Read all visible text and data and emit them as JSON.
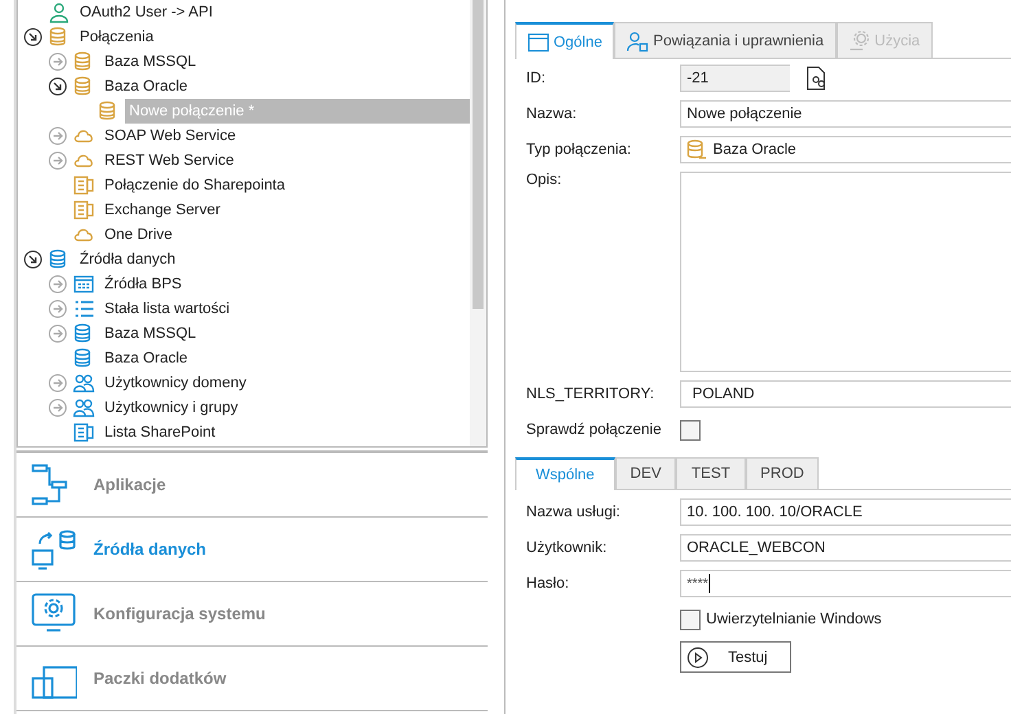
{
  "tree": [
    {
      "label": "OAuth2 User -> API",
      "kind": "user",
      "color": "#2aa87a",
      "selected": false
    },
    {
      "label": "Połączenia",
      "kind": "database",
      "color": "#d9a441",
      "expanded": true,
      "selected": false,
      "children": [
        {
          "label": "Baza MSSQL",
          "kind": "database",
          "color": "#d9a441",
          "expanded": false,
          "selected": false
        },
        {
          "label": "Baza Oracle",
          "kind": "database",
          "color": "#d9a441",
          "expanded": true,
          "selected": false,
          "children": [
            {
              "label": "Nowe połączenie *",
              "kind": "database",
              "color": "#d9a441",
              "selected": true
            }
          ]
        },
        {
          "label": "SOAP Web Service",
          "kind": "cloud",
          "color": "#d9a441",
          "expanded": false,
          "selected": false
        },
        {
          "label": "REST Web Service",
          "kind": "cloud",
          "color": "#d9a441",
          "expanded": false,
          "selected": false
        },
        {
          "label": "Połączenie do Sharepointa",
          "kind": "document",
          "color": "#d9a441",
          "selected": false
        },
        {
          "label": "Exchange Server",
          "kind": "document",
          "color": "#d9a441",
          "selected": false
        },
        {
          "label": "One Drive",
          "kind": "cloud",
          "color": "#d9a441",
          "selected": false
        }
      ]
    },
    {
      "label": "Źródła danych",
      "kind": "database",
      "color": "#1a8fd8",
      "expanded": true,
      "selected": false,
      "children": [
        {
          "label": "Źródła BPS",
          "kind": "grid",
          "color": "#1a8fd8",
          "expanded": false,
          "selected": false
        },
        {
          "label": "Stała lista wartości",
          "kind": "list",
          "color": "#1a8fd8",
          "expanded": false,
          "selected": false
        },
        {
          "label": "Baza MSSQL",
          "kind": "database",
          "color": "#1a8fd8",
          "expanded": false,
          "selected": false
        },
        {
          "label": "Baza Oracle",
          "kind": "database",
          "color": "#1a8fd8",
          "selected": false
        },
        {
          "label": "Użytkownicy domeny",
          "kind": "users",
          "color": "#1a8fd8",
          "expanded": false,
          "selected": false
        },
        {
          "label": "Użytkownicy i grupy",
          "kind": "users",
          "color": "#1a8fd8",
          "expanded": false,
          "selected": false
        },
        {
          "label": "Lista SharePoint",
          "kind": "document",
          "color": "#1a8fd8",
          "selected": false
        }
      ]
    }
  ],
  "nav": [
    {
      "label": "Aplikacje",
      "selected": false
    },
    {
      "label": "Źródła danych",
      "selected": true
    },
    {
      "label": "Konfiguracja systemu",
      "selected": false
    },
    {
      "label": "Paczki dodatków",
      "selected": false
    }
  ],
  "tabs": [
    {
      "label": "Ogólne",
      "selected": true,
      "disabled": false
    },
    {
      "label": "Powiązania i uprawnienia",
      "selected": false,
      "disabled": false
    },
    {
      "label": "Użycia",
      "selected": false,
      "disabled": true
    }
  ],
  "form": {
    "id": {
      "label": "ID:",
      "value": "-21"
    },
    "name": {
      "label": "Nazwa:",
      "value": "Nowe połączenie"
    },
    "type": {
      "label": "Typ połączenia:",
      "value": "Baza Oracle"
    },
    "description": {
      "label": "Opis:"
    },
    "nls": {
      "label": "NLS_TERRITORY:",
      "value": "POLAND"
    },
    "check": {
      "label": "Sprawdź połączenie",
      "checked": false
    }
  },
  "env_tabs": [
    {
      "label": "Wspólne",
      "selected": true
    },
    {
      "label": "DEV",
      "selected": false
    },
    {
      "label": "TEST",
      "selected": false
    },
    {
      "label": "PROD",
      "selected": false
    }
  ],
  "connection": {
    "service": {
      "label": "Nazwa usługi:",
      "value": "10. 100. 100. 10/ORACLE"
    },
    "user": {
      "label": "Użytkownik:",
      "value": "ORACLE_WEBCON"
    },
    "password": {
      "label": "Hasło:",
      "value": "****"
    },
    "windows_auth": {
      "label": "Uwierzytelnianie Windows",
      "checked": false
    },
    "test_button": "Testuj"
  }
}
